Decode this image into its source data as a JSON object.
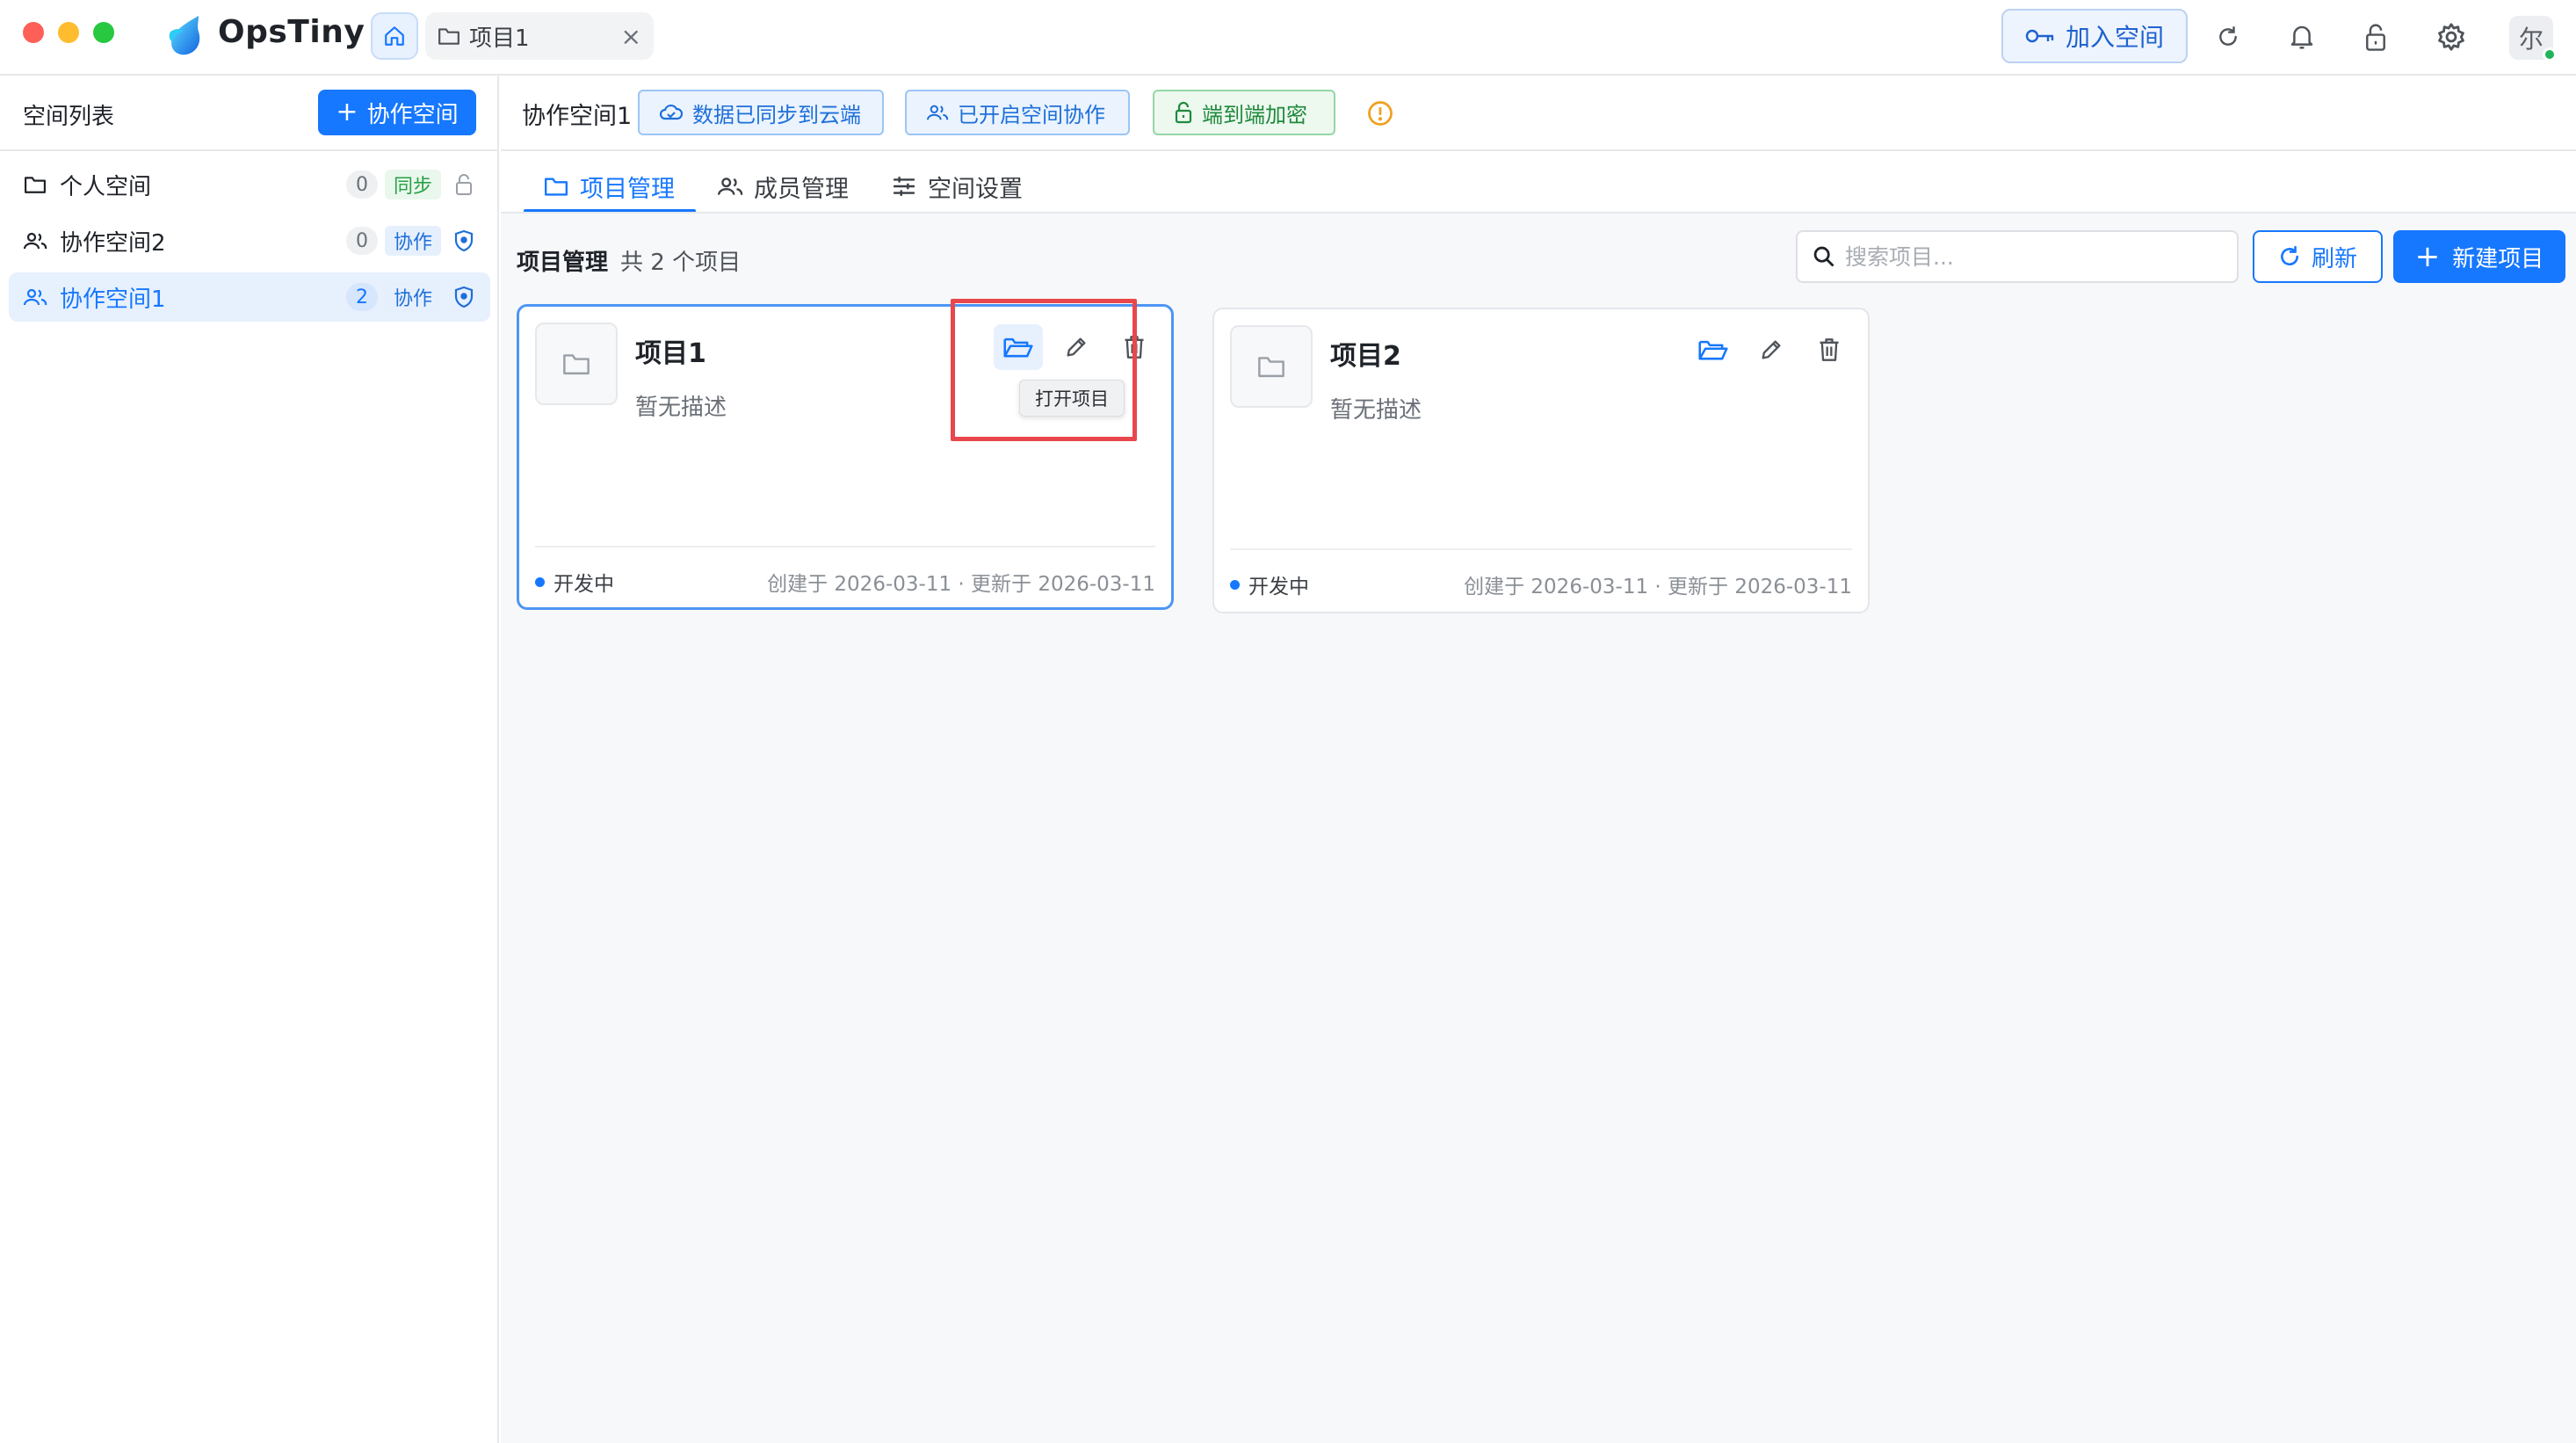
{
  "app": {
    "name": "OpsTiny"
  },
  "titlebar": {
    "tabs": [
      {
        "label": "项目1",
        "close": "×"
      }
    ],
    "join_label": "加入空间",
    "avatar_text": "尔"
  },
  "sidebar": {
    "heading": "空间列表",
    "add_label": "协作空间",
    "items": [
      {
        "name": "个人空间",
        "count": "0",
        "badge": "同步",
        "icon": "folder-icon",
        "tail_icon": "lock-icon"
      },
      {
        "name": "协作空间2",
        "count": "0",
        "badge": "协作",
        "icon": "users-icon",
        "tail_icon": "shield-icon"
      },
      {
        "name": "协作空间1",
        "count": "2",
        "badge": "协作",
        "icon": "users-icon",
        "tail_icon": "shield-icon",
        "active": true
      }
    ]
  },
  "space": {
    "title": "协作空间1",
    "status_tags": [
      {
        "label": "数据已同步到云端",
        "icon": "cloud-icon"
      },
      {
        "label": "已开启空间协作",
        "icon": "users-icon"
      },
      {
        "label": "端到端加密",
        "icon": "lock-icon"
      }
    ]
  },
  "tabs": [
    {
      "label": "项目管理",
      "icon": "folder-icon",
      "active": true
    },
    {
      "label": "成员管理",
      "icon": "users-icon"
    },
    {
      "label": "空间设置",
      "icon": "sliders-icon"
    }
  ],
  "projects_section": {
    "title": "项目管理",
    "count_text": "共 2 个项目",
    "search_placeholder": "搜索项目...",
    "refresh_label": "刷新",
    "new_label": "新建项目"
  },
  "projects": [
    {
      "title": "项目1",
      "description": "暂无描述",
      "status": "开发中",
      "dates": "创建于 2026-03-11 · 更新于 2026-03-11"
    },
    {
      "title": "项目2",
      "description": "暂无描述",
      "status": "开发中",
      "dates": "创建于 2026-03-11 · 更新于 2026-03-11"
    }
  ],
  "tooltip": {
    "text": "打开项目"
  },
  "colors": {
    "primary": "#1677ff",
    "highlight": "#e8474c",
    "sync_green": "#27a046"
  }
}
